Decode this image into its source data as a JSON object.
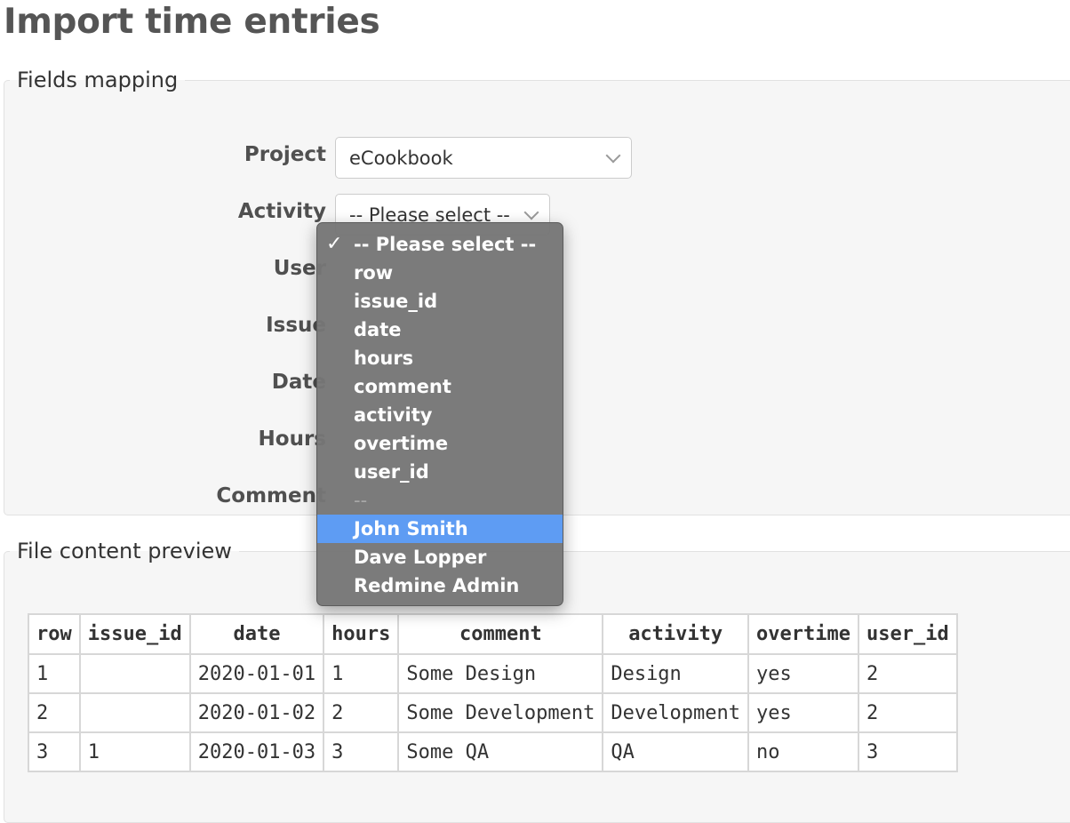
{
  "page": {
    "title": "Import time entries"
  },
  "fields_mapping": {
    "legend": "Fields mapping",
    "project": {
      "label": "Project",
      "value": "eCookbook"
    },
    "activity": {
      "label": "Activity",
      "value": "-- Please select --"
    },
    "user": {
      "label": "User"
    },
    "issue": {
      "label": "Issue"
    },
    "date": {
      "label": "Date"
    },
    "hours": {
      "label": "Hours"
    },
    "comment": {
      "label": "Comment"
    }
  },
  "dropdown": {
    "check_glyph": "✓",
    "options": [
      "-- Please select --",
      "row",
      "issue_id",
      "date",
      "hours",
      "comment",
      "activity",
      "overtime",
      "user_id",
      "--",
      "John Smith",
      "Dave Lopper",
      "Redmine Admin"
    ],
    "selected_index": 0,
    "highlighted_index": 10
  },
  "preview": {
    "legend": "File content preview",
    "columns": [
      "row",
      "issue_id",
      "date",
      "hours",
      "comment",
      "activity",
      "overtime",
      "user_id"
    ],
    "rows": [
      [
        "1",
        "",
        "2020-01-01",
        "1",
        "Some Design",
        "Design",
        "yes",
        "2"
      ],
      [
        "2",
        "",
        "2020-01-02",
        "2",
        "Some Development",
        "Development",
        "yes",
        "2"
      ],
      [
        "3",
        "1",
        "2020-01-03",
        "3",
        "Some QA",
        "QA",
        "no",
        "3"
      ]
    ]
  },
  "colors": {
    "highlight": "#5e9cf3",
    "menu_background": "#767676",
    "panel_background": "#f6f6f6"
  }
}
